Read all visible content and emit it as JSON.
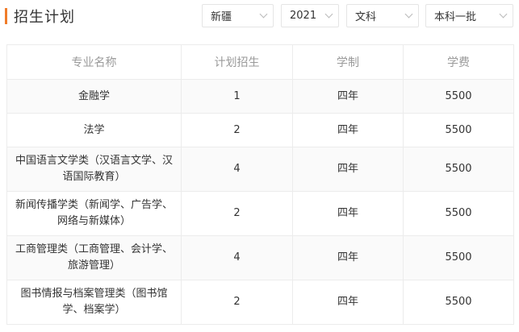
{
  "header": {
    "title": "招生计划",
    "filters": {
      "province": "新疆",
      "year": "2021",
      "subject": "文科",
      "batch": "本科一批"
    }
  },
  "table": {
    "columns": [
      "专业名称",
      "计划招生",
      "学制",
      "学费"
    ],
    "rows": [
      {
        "major": "金融学",
        "plan": "1",
        "duration": "四年",
        "tuition": "5500"
      },
      {
        "major": "法学",
        "plan": "2",
        "duration": "四年",
        "tuition": "5500"
      },
      {
        "major": "中国语言文学类（汉语言文学、汉语国际教育）",
        "plan": "4",
        "duration": "四年",
        "tuition": "5500"
      },
      {
        "major": "新闻传播学类（新闻学、广告学、网络与新媒体）",
        "plan": "2",
        "duration": "四年",
        "tuition": "5500"
      },
      {
        "major": "工商管理类（工商管理、会计学、旅游管理）",
        "plan": "4",
        "duration": "四年",
        "tuition": "5500"
      },
      {
        "major": "图书情报与档案管理类（图书馆学、档案学）",
        "plan": "2",
        "duration": "四年",
        "tuition": "5500"
      }
    ]
  },
  "colors": {
    "accent": "#f07c2a",
    "border": "#ececec",
    "header_text": "#9a9a9a",
    "body_text": "#333333",
    "alt_row_bg": "#fafafa"
  }
}
